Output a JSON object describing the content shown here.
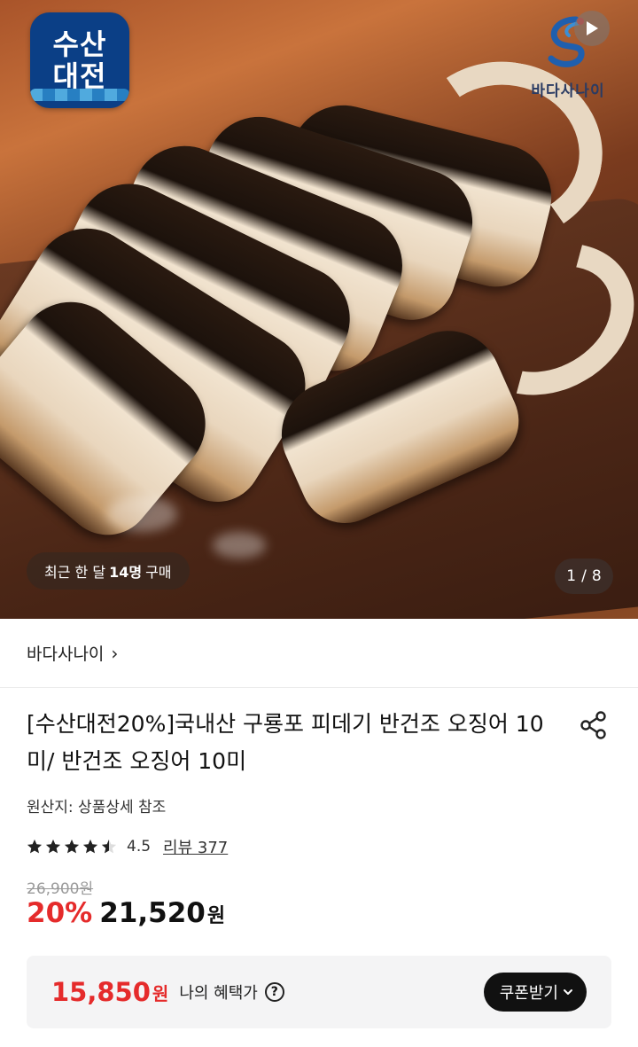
{
  "hero": {
    "brand_badge_line1": "수산",
    "brand_badge_line2": "대전",
    "seller_logo_text": "바다사나이",
    "buyers_prefix": "최근 한 달",
    "buyers_count": "14명",
    "buyers_suffix": "구매",
    "image_index": "1",
    "image_separator": "/",
    "image_total": "8"
  },
  "store": {
    "name": "바다사나이",
    "chevron": "›"
  },
  "product": {
    "title": "[수산대전20%]국내산 구룡포 피데기 반건조 오징어 10미/ 반건조 오징어 10미",
    "origin": "원산지: 상품상세 참조",
    "rating": "4.5",
    "rating_stars": 4.5,
    "review_label": "리뷰 377",
    "original_price": "26,900원",
    "discount": "20%",
    "sale_price": "21,520",
    "currency": "원"
  },
  "benefit": {
    "price": "15,850",
    "currency": "원",
    "label": "나의 혜택가",
    "help": "?",
    "coupon_button": "쿠폰받기"
  },
  "colors": {
    "accent_red": "#e52b2b",
    "badge_blue": "#0b3f86",
    "button_black": "#111111"
  }
}
